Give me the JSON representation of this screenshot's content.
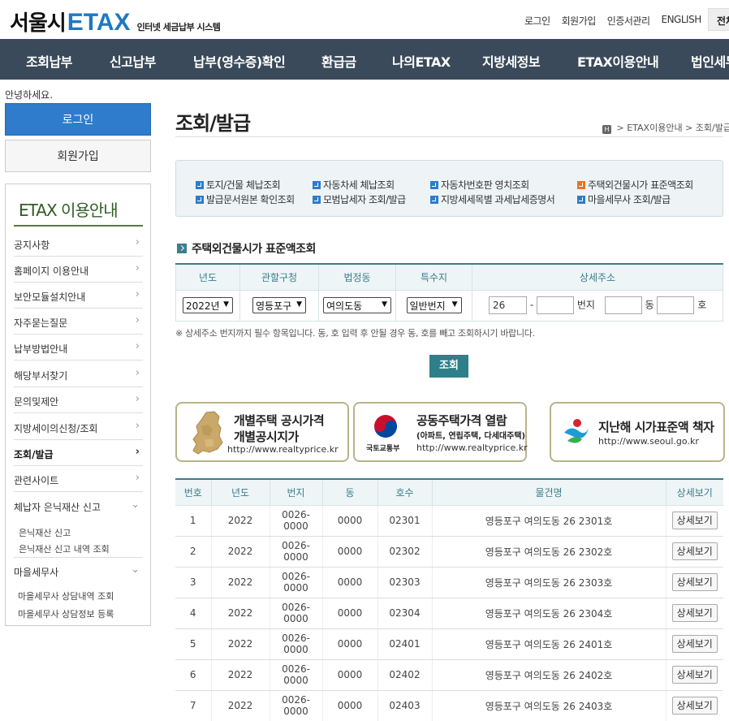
{
  "header": {
    "logo_kr": "서울시",
    "logo_etax": "ETAX",
    "logo_sub": "인터넷 세금납부 시스템",
    "links": [
      "로그인",
      "회원가입",
      "인증서관리",
      "ENGLISH"
    ],
    "all_button": "전체"
  },
  "gnb": [
    "조회납부",
    "신고납부",
    "납부(영수증)확인",
    "환급금",
    "나의ETAX",
    "지방세정보",
    "ETAX이용안내",
    "법인세무"
  ],
  "left": {
    "hello": "안녕하세요.",
    "login": "로그인",
    "join": "회원가입",
    "menu_title": "ETAX 이용안내",
    "menu": [
      {
        "label": "공지사항"
      },
      {
        "label": "홈페이지 이용안내"
      },
      {
        "label": "보안모듈설치안내"
      },
      {
        "label": "자주묻는질문"
      },
      {
        "label": "납부방법안내"
      },
      {
        "label": "해당부서찾기"
      },
      {
        "label": "문의및제안"
      },
      {
        "label": "지방세이의신청/조회"
      },
      {
        "label": "조회/발급"
      },
      {
        "label": "관련사이트"
      },
      {
        "label": "체납자 은닉재산 신고"
      },
      {
        "label": "마을세무사"
      }
    ],
    "sub_hidden": [
      "은닉재산 신고",
      "은닉재산 신고 내역 조회"
    ],
    "sub_village": [
      "마을세무사 상담내역 조회",
      "마을세무사 상담정보 등록"
    ]
  },
  "main": {
    "title": "조회/발급",
    "breadcrumb_home": "H",
    "breadcrumb": [
      "ETAX이용안내",
      "조회/발급"
    ],
    "quick_links": [
      {
        "label": "토지/건물 체납조회",
        "color": "#2e7ccb"
      },
      {
        "label": "자동차세 체납조회",
        "color": "#2e7ccb"
      },
      {
        "label": "자동차번호판 영치조회",
        "color": "#2e7ccb"
      },
      {
        "label": "주택외건물시가 표준액조회",
        "color": "#e8742a"
      },
      {
        "label": "발급문서원본 확인조회",
        "color": "#2e7ccb"
      },
      {
        "label": "모범납세자 조회/발급",
        "color": "#2e7ccb"
      },
      {
        "label": "지방세세목별 과세납세증명서",
        "color": "#2e7ccb"
      },
      {
        "label": "마을세무사 조회/발급",
        "color": "#2e7ccb"
      }
    ],
    "section_title": "주택외건물시가 표준액조회",
    "form": {
      "headers": [
        "년도",
        "관할구청",
        "법정동",
        "특수지",
        "상세주소"
      ],
      "year": "2022년",
      "district": "영등포구",
      "dong": "여의도동",
      "special": "일반번지",
      "bunji_main": "26",
      "bunji_sub": "",
      "bunji_label": "번지",
      "dong_no": "",
      "dong_label": "동",
      "ho_no": "",
      "ho_label": "호",
      "dash": "-"
    },
    "note": "※ 상세주소 번지까지 필수 항목입니다. 동, 호 입력 후 안될 경우 동, 호를 빼고 조회하시기 바랍니다.",
    "search_button": "조회",
    "banners": [
      {
        "line1": "개별주택 공시가격",
        "line2": "개별공시지가",
        "url": "http://www.realtyprice.kr",
        "icon": "korea-map-icon"
      },
      {
        "line1": "공동주택가격 열람",
        "line2": "(아파트, 연립주택, 다세대주택)",
        "url": "http://www.realtyprice.kr",
        "icon_label": "국토교통부",
        "icon": "ministry-emblem-icon"
      },
      {
        "line1": "지난해 시가표준액 책자",
        "url": "http://www.seoul.go.kr",
        "icon": "seoul-logo-icon"
      }
    ],
    "list": {
      "headers": [
        "번호",
        "년도",
        "번지",
        "동",
        "호수",
        "물건명",
        "상세보기"
      ],
      "button_label": "상세보기",
      "rows": [
        {
          "no": "1",
          "year": "2022",
          "bunji": "0026-0000",
          "dong": "0000",
          "ho": "02301",
          "name": "영등포구 여의도동 26 2301호"
        },
        {
          "no": "2",
          "year": "2022",
          "bunji": "0026-0000",
          "dong": "0000",
          "ho": "02302",
          "name": "영등포구 여의도동 26 2302호"
        },
        {
          "no": "3",
          "year": "2022",
          "bunji": "0026-0000",
          "dong": "0000",
          "ho": "02303",
          "name": "영등포구 여의도동 26 2303호"
        },
        {
          "no": "4",
          "year": "2022",
          "bunji": "0026-0000",
          "dong": "0000",
          "ho": "02304",
          "name": "영등포구 여의도동 26 2304호"
        },
        {
          "no": "5",
          "year": "2022",
          "bunji": "0026-0000",
          "dong": "0000",
          "ho": "02401",
          "name": "영등포구 여의도동 26 2401호"
        },
        {
          "no": "6",
          "year": "2022",
          "bunji": "0026-0000",
          "dong": "0000",
          "ho": "02402",
          "name": "영등포구 여의도동 26 2402호"
        },
        {
          "no": "7",
          "year": "2022",
          "bunji": "0026-0000",
          "dong": "0000",
          "ho": "02403",
          "name": "영등포구 여의도동 26 2403호"
        }
      ]
    }
  }
}
